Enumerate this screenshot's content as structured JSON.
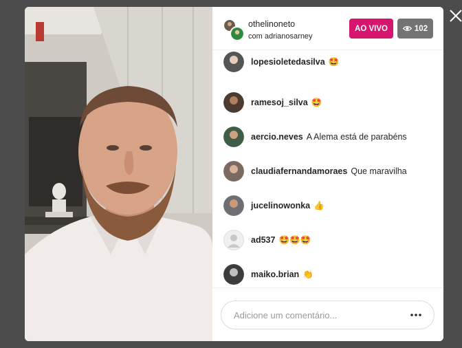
{
  "header": {
    "host_username": "othelinoneto",
    "host_subtitle": "com adrianosarney",
    "live_label": "AO VIVO",
    "viewer_count": "102",
    "live_color": "#d6156f"
  },
  "comments": [
    {
      "username": "lopesioletedasilva",
      "text": "🤩",
      "avatar_color": "#555555"
    },
    {
      "username": "ramesoj_silva",
      "text": "🤩",
      "avatar_color": "#4a3a30"
    },
    {
      "username": "aercio.neves",
      "text": "A Alema está de parabéns",
      "avatar_color": "#3f5d46"
    },
    {
      "username": "claudiafernandamoraes",
      "text": "Que maravilha",
      "avatar_color": "#7a6a5f"
    },
    {
      "username": "jucelinowonka",
      "text": "👍",
      "avatar_color": "#6d6f73"
    },
    {
      "username": "ad537",
      "text": "🤩🤩🤩",
      "avatar_color": "#dbdbdb"
    },
    {
      "username": "maiko.brian",
      "text": "👏",
      "avatar_color": "#3c3c3c"
    }
  ],
  "footer": {
    "comment_placeholder": "Adicione um comentário..."
  },
  "icons": {
    "close": "close-icon",
    "eye": "eye-icon",
    "more": "more-options-icon"
  }
}
